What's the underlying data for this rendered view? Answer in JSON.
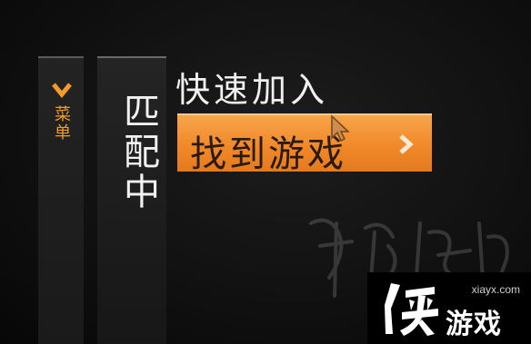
{
  "menu": {
    "label": "菜单",
    "icon": "chevron-down-icon",
    "accent": "#f39a2a"
  },
  "status": {
    "label": "匹配中"
  },
  "quick_join": {
    "title": "快速加入",
    "find_game_label": "找到游戏",
    "button_color": "#f1892a",
    "arrow_icon": "chevron-right-icon"
  },
  "watermark": {
    "url": "xiayx.com",
    "logo_text": "侠",
    "name": "游戏",
    "script_text": "游侠网"
  }
}
